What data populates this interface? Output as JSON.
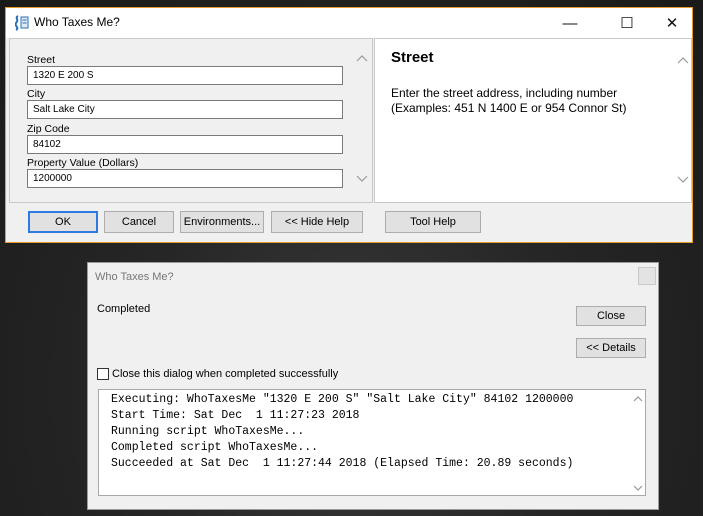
{
  "main_dialog": {
    "title": "Who Taxes Me?",
    "controls": {
      "minimize": "—",
      "maximize": "☐",
      "close": "✕"
    },
    "fields": [
      {
        "label": "Street",
        "value": "1320 E 200 S"
      },
      {
        "label": "City",
        "value": "Salt Lake City"
      },
      {
        "label": "Zip Code",
        "value": "84102"
      },
      {
        "label": "Property Value (Dollars)",
        "value": "1200000"
      }
    ],
    "help": {
      "title": "Street",
      "line1": "Enter the street address, including number",
      "line2": "(Examples: 451 N 1400 E or 954 Connor St)"
    },
    "buttons": {
      "ok": "OK",
      "cancel": "Cancel",
      "environments": "Environments...",
      "hide_help": "<< Hide Help",
      "tool_help": "Tool Help"
    }
  },
  "progress_dialog": {
    "title": "Who Taxes Me?",
    "status": "Completed",
    "close_button": "Close",
    "details_button": "<< Details",
    "checkbox_label": "Close this dialog when completed successfully",
    "log": [
      "Executing: WhoTaxesMe \"1320 E 200 S\" \"Salt Lake City\" 84102 1200000",
      "Start Time: Sat Dec  1 11:27:23 2018",
      "Running script WhoTaxesMe...",
      "Completed script WhoTaxesMe...",
      "Succeeded at Sat Dec  1 11:27:44 2018 (Elapsed Time: 20.89 seconds)"
    ]
  },
  "colors": {
    "accent_border": "#e69a2b",
    "default_button": "#2c7be5"
  }
}
